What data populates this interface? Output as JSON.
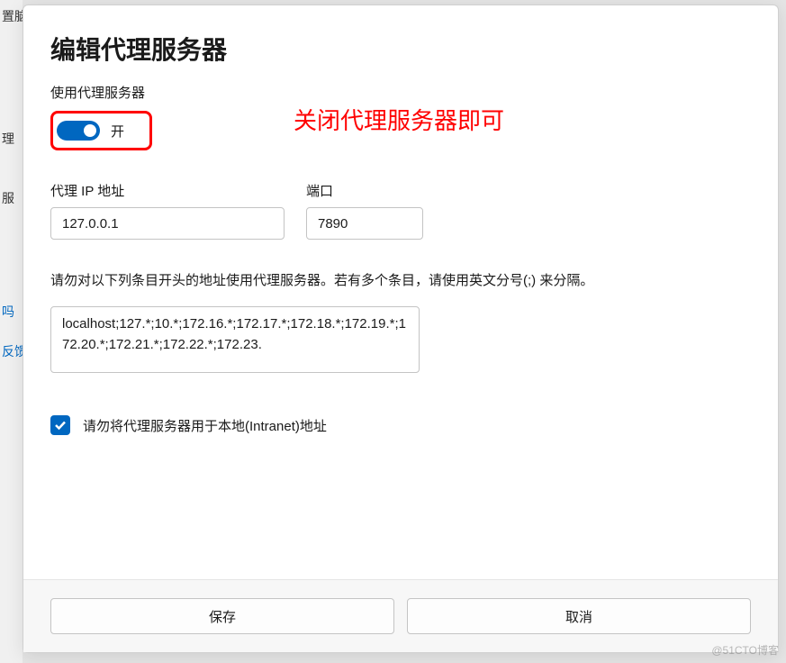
{
  "background": {
    "item1": "置脑",
    "item2": "理",
    "item3": "服",
    "item4": "吗",
    "item5": "反馈"
  },
  "dialog": {
    "title": "编辑代理服务器",
    "toggle_section_label": "使用代理服务器",
    "toggle_state": "开",
    "annotation": "关闭代理服务器即可",
    "ip_label": "代理 IP 地址",
    "ip_value": "127.0.0.1",
    "port_label": "端口",
    "port_value": "7890",
    "exclusion_desc": "请勿对以下列条目开头的地址使用代理服务器。若有多个条目，请使用英文分号(;) 来分隔。",
    "exclusion_value": "localhost;127.*;10.*;172.16.*;172.17.*;172.18.*;172.19.*;172.20.*;172.21.*;172.22.*;172.23.",
    "intranet_checkbox_label": "请勿将代理服务器用于本地(Intranet)地址",
    "save_label": "保存",
    "cancel_label": "取消"
  },
  "watermark": "@51CTO博客"
}
